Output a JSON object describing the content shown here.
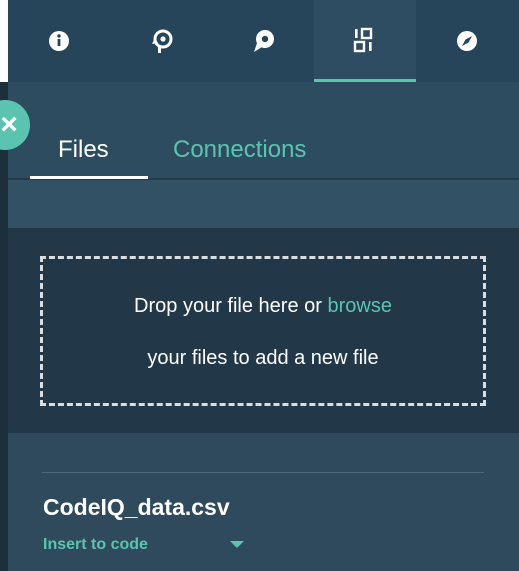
{
  "toolbar": {
    "icons": [
      {
        "name": "info-icon"
      },
      {
        "name": "history-icon"
      },
      {
        "name": "comment-icon"
      },
      {
        "name": "data-icon",
        "active": true
      },
      {
        "name": "compass-icon"
      }
    ]
  },
  "panel": {
    "tabs": [
      {
        "label": "Files",
        "active": true
      },
      {
        "label": "Connections",
        "active": false
      }
    ],
    "dropzone": {
      "line1_prefix": "Drop your file here or ",
      "line1_link": "browse",
      "line2": "your files to add a new file"
    },
    "file": {
      "name": "CodeIQ_data.csv",
      "action_label": "Insert to code"
    }
  },
  "colors": {
    "accent": "#5bc4b0",
    "toolbar_bg": "#27455a",
    "panel_bg": "#2f4a5c",
    "drop_bg": "#223849"
  }
}
